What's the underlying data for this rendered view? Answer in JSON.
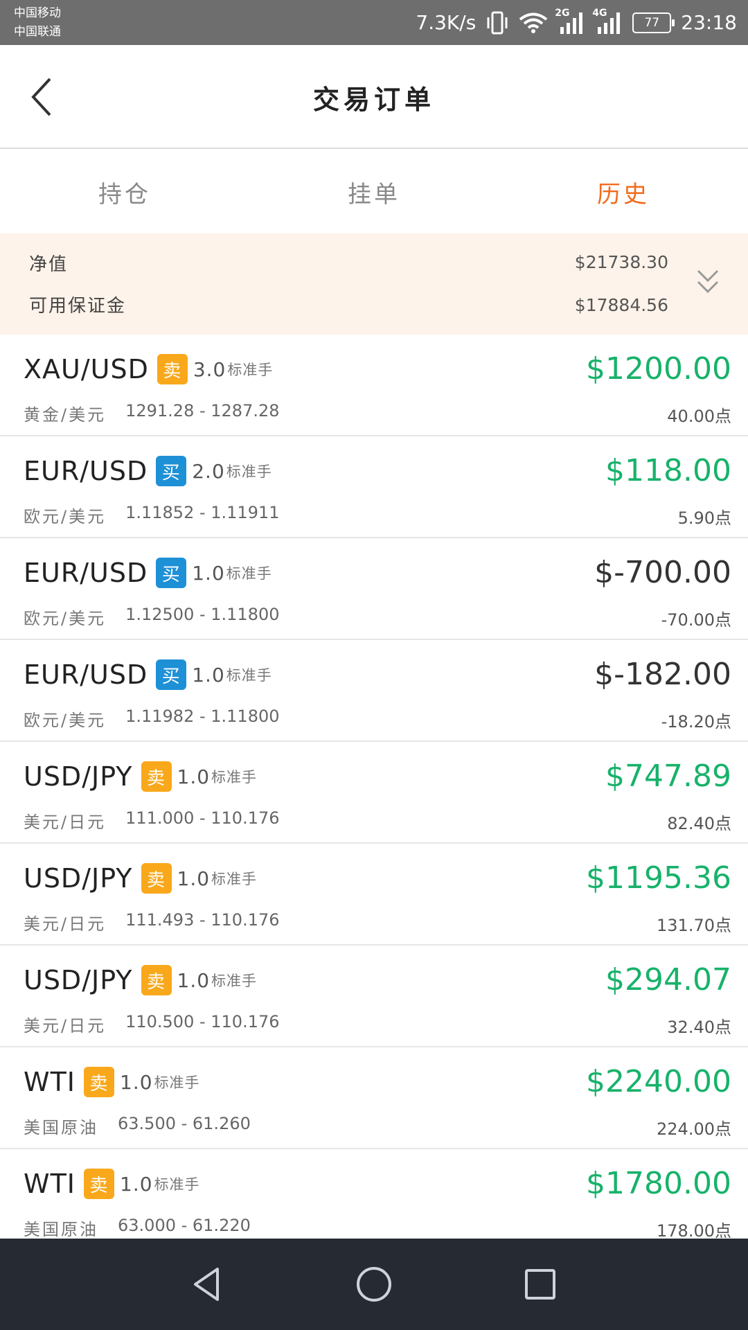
{
  "status_bar": {
    "carrier_1": "中国移动",
    "carrier_2": "中国联通",
    "network_speed": "7.3K/s",
    "net_2g": "2G",
    "net_4g": "4G",
    "battery": "77",
    "time": "23:18"
  },
  "header": {
    "title": "交易订单"
  },
  "tabs": [
    {
      "label": "持仓",
      "active": false
    },
    {
      "label": "挂单",
      "active": false
    },
    {
      "label": "历史",
      "active": true
    }
  ],
  "summary": {
    "net_value_label": "净值",
    "net_value": "$21738.30",
    "margin_label": "可用保证金",
    "margin_value": "$17884.56"
  },
  "lot_unit": "标准手",
  "orders": [
    {
      "symbol": "XAU/USD",
      "side": "卖",
      "side_type": "sell",
      "lots": "3.0",
      "name": "黄金/美元",
      "prices": "1291.28 - 1287.28",
      "profit": "$1200.00",
      "profit_sign": "pos",
      "points": "40.00点"
    },
    {
      "symbol": "EUR/USD",
      "side": "买",
      "side_type": "buy",
      "lots": "2.0",
      "name": "欧元/美元",
      "prices": "1.11852 - 1.11911",
      "profit": "$118.00",
      "profit_sign": "pos",
      "points": "5.90点"
    },
    {
      "symbol": "EUR/USD",
      "side": "买",
      "side_type": "buy",
      "lots": "1.0",
      "name": "欧元/美元",
      "prices": "1.12500 - 1.11800",
      "profit": "$-700.00",
      "profit_sign": "neg",
      "points": "-70.00点"
    },
    {
      "symbol": "EUR/USD",
      "side": "买",
      "side_type": "buy",
      "lots": "1.0",
      "name": "欧元/美元",
      "prices": "1.11982 - 1.11800",
      "profit": "$-182.00",
      "profit_sign": "neg",
      "points": "-18.20点"
    },
    {
      "symbol": "USD/JPY",
      "side": "卖",
      "side_type": "sell",
      "lots": "1.0",
      "name": "美元/日元",
      "prices": "111.000 - 110.176",
      "profit": "$747.89",
      "profit_sign": "pos",
      "points": "82.40点"
    },
    {
      "symbol": "USD/JPY",
      "side": "卖",
      "side_type": "sell",
      "lots": "1.0",
      "name": "美元/日元",
      "prices": "111.493 - 110.176",
      "profit": "$1195.36",
      "profit_sign": "pos",
      "points": "131.70点"
    },
    {
      "symbol": "USD/JPY",
      "side": "卖",
      "side_type": "sell",
      "lots": "1.0",
      "name": "美元/日元",
      "prices": "110.500 - 110.176",
      "profit": "$294.07",
      "profit_sign": "pos",
      "points": "32.40点"
    },
    {
      "symbol": "WTI",
      "side": "卖",
      "side_type": "sell",
      "lots": "1.0",
      "name": "美国原油",
      "prices": "63.500 - 61.260",
      "profit": "$2240.00",
      "profit_sign": "pos",
      "points": "224.00点"
    },
    {
      "symbol": "WTI",
      "side": "卖",
      "side_type": "sell",
      "lots": "1.0",
      "name": "美国原油",
      "prices": "63.000 - 61.220",
      "profit": "$1780.00",
      "profit_sign": "pos",
      "points": "178.00点"
    }
  ],
  "colors": {
    "accent": "#f26b1d",
    "profit_positive": "#17b26a",
    "sell_badge": "#f9a81b",
    "buy_badge": "#1e90d6",
    "summary_bg": "#fdf3ea"
  },
  "icons": {
    "back": "chevron-left-icon",
    "expand": "double-chevron-down-icon",
    "nav_back": "triangle-back-icon",
    "nav_home": "circle-home-icon",
    "nav_recent": "square-recent-icon"
  }
}
